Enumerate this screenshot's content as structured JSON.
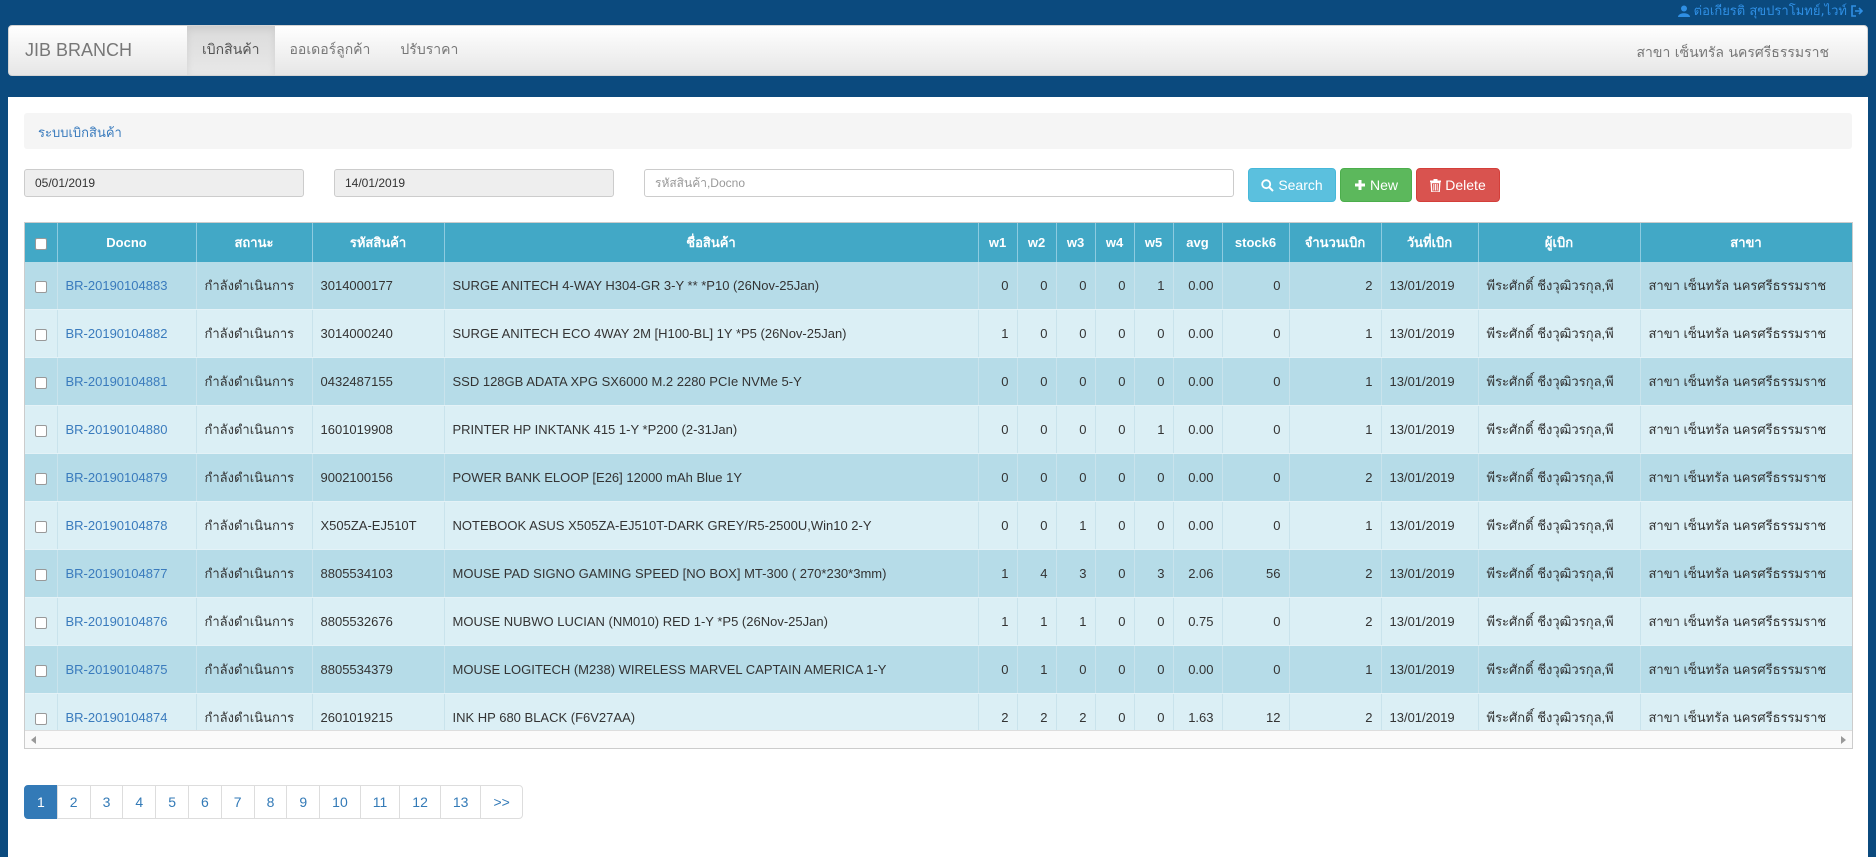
{
  "topbar": {
    "user_name": "ต่อเกียรติ สุขปราโมทย์,ไวท์"
  },
  "navbar": {
    "brand": "JIB BRANCH",
    "items": [
      {
        "label": "เบิกสินค้า",
        "active": true
      },
      {
        "label": "ออเดอร์ลูกค้า",
        "active": false
      },
      {
        "label": "ปรับราคา",
        "active": false
      }
    ],
    "branch": "สาขา เซ็นทรัล นครศรีธรรมราช"
  },
  "panel": {
    "title": "ระบบเบิกสินค้า"
  },
  "filters": {
    "date_from": "05/01/2019",
    "date_to": "14/01/2019",
    "search_placeholder": "รหัสสินค้า,Docno",
    "search_label": "Search",
    "new_label": "New",
    "delete_label": "Delete"
  },
  "table": {
    "columns": [
      "Docno",
      "สถานะ",
      "รหัสสินค้า",
      "ชื่อสินค้า",
      "w1",
      "w2",
      "w3",
      "w4",
      "w5",
      "avg",
      "stock6",
      "จำนวนเบิก",
      "วันที่เบิก",
      "ผู้เบิก",
      "สาขา"
    ],
    "rows": [
      {
        "docno": "BR-20190104883",
        "status": "กำลังดำเนินการ",
        "code": "3014000177",
        "name": "SURGE ANITECH 4-WAY H304-GR 3-Y ** *P10 (26Nov-25Jan)",
        "w1": "0",
        "w2": "0",
        "w3": "0",
        "w4": "0",
        "w5": "1",
        "avg": "0.00",
        "stock6": "0",
        "qty": "2",
        "date": "13/01/2019",
        "requester": "พีระศักดิ์ ชีงวุฒิวรกุล,พี",
        "branch": "สาขา เซ็นทรัล นครศรีธรรมราช"
      },
      {
        "docno": "BR-20190104882",
        "status": "กำลังดำเนินการ",
        "code": "3014000240",
        "name": "SURGE ANITECH ECO 4WAY 2M [H100-BL] 1Y *P5 (26Nov-25Jan)",
        "w1": "1",
        "w2": "0",
        "w3": "0",
        "w4": "0",
        "w5": "0",
        "avg": "0.00",
        "stock6": "0",
        "qty": "1",
        "date": "13/01/2019",
        "requester": "พีระศักดิ์ ชีงวุฒิวรกุล,พี",
        "branch": "สาขา เซ็นทรัล นครศรีธรรมราช"
      },
      {
        "docno": "BR-20190104881",
        "status": "กำลังดำเนินการ",
        "code": "0432487155",
        "name": "SSD 128GB ADATA XPG SX6000 M.2 2280 PCIe NVMe 5-Y",
        "w1": "0",
        "w2": "0",
        "w3": "0",
        "w4": "0",
        "w5": "0",
        "avg": "0.00",
        "stock6": "0",
        "qty": "1",
        "date": "13/01/2019",
        "requester": "พีระศักดิ์ ชีงวุฒิวรกุล,พี",
        "branch": "สาขา เซ็นทรัล นครศรีธรรมราช"
      },
      {
        "docno": "BR-20190104880",
        "status": "กำลังดำเนินการ",
        "code": "1601019908",
        "name": "PRINTER HP INKTANK 415 1-Y *P200 (2-31Jan)",
        "w1": "0",
        "w2": "0",
        "w3": "0",
        "w4": "0",
        "w5": "1",
        "avg": "0.00",
        "stock6": "0",
        "qty": "1",
        "date": "13/01/2019",
        "requester": "พีระศักดิ์ ชีงวุฒิวรกุล,พี",
        "branch": "สาขา เซ็นทรัล นครศรีธรรมราช"
      },
      {
        "docno": "BR-20190104879",
        "status": "กำลังดำเนินการ",
        "code": "9002100156",
        "name": "POWER BANK ELOOP [E26] 12000 mAh Blue 1Y",
        "w1": "0",
        "w2": "0",
        "w3": "0",
        "w4": "0",
        "w5": "0",
        "avg": "0.00",
        "stock6": "0",
        "qty": "2",
        "date": "13/01/2019",
        "requester": "พีระศักดิ์ ชีงวุฒิวรกุล,พี",
        "branch": "สาขา เซ็นทรัล นครศรีธรรมราช"
      },
      {
        "docno": "BR-20190104878",
        "status": "กำลังดำเนินการ",
        "code": "X505ZA-EJ510T",
        "name": "NOTEBOOK ASUS X505ZA-EJ510T-DARK GREY/R5-2500U,Win10 2-Y",
        "w1": "0",
        "w2": "0",
        "w3": "1",
        "w4": "0",
        "w5": "0",
        "avg": "0.00",
        "stock6": "0",
        "qty": "1",
        "date": "13/01/2019",
        "requester": "พีระศักดิ์ ชีงวุฒิวรกุล,พี",
        "branch": "สาขา เซ็นทรัล นครศรีธรรมราช"
      },
      {
        "docno": "BR-20190104877",
        "status": "กำลังดำเนินการ",
        "code": "8805534103",
        "name": "MOUSE PAD SIGNO GAMING SPEED [NO BOX] MT-300 ( 270*230*3mm)",
        "w1": "1",
        "w2": "4",
        "w3": "3",
        "w4": "0",
        "w5": "3",
        "avg": "2.06",
        "stock6": "56",
        "qty": "2",
        "date": "13/01/2019",
        "requester": "พีระศักดิ์ ชีงวุฒิวรกุล,พี",
        "branch": "สาขา เซ็นทรัล นครศรีธรรมราช"
      },
      {
        "docno": "BR-20190104876",
        "status": "กำลังดำเนินการ",
        "code": "8805532676",
        "name": "MOUSE NUBWO LUCIAN (NM010) RED 1-Y *P5 (26Nov-25Jan)",
        "w1": "1",
        "w2": "1",
        "w3": "1",
        "w4": "0",
        "w5": "0",
        "avg": "0.75",
        "stock6": "0",
        "qty": "2",
        "date": "13/01/2019",
        "requester": "พีระศักดิ์ ชีงวุฒิวรกุล,พี",
        "branch": "สาขา เซ็นทรัล นครศรีธรรมราช"
      },
      {
        "docno": "BR-20190104875",
        "status": "กำลังดำเนินการ",
        "code": "8805534379",
        "name": "MOUSE LOGITECH (M238) WIRELESS MARVEL CAPTAIN AMERICA 1-Y",
        "w1": "0",
        "w2": "1",
        "w3": "0",
        "w4": "0",
        "w5": "0",
        "avg": "0.00",
        "stock6": "0",
        "qty": "1",
        "date": "13/01/2019",
        "requester": "พีระศักดิ์ ชีงวุฒิวรกุล,พี",
        "branch": "สาขา เซ็นทรัล นครศรีธรรมราช"
      },
      {
        "docno": "BR-20190104874",
        "status": "กำลังดำเนินการ",
        "code": "2601019215",
        "name": "INK HP 680 BLACK (F6V27AA)",
        "w1": "2",
        "w2": "2",
        "w3": "2",
        "w4": "0",
        "w5": "0",
        "avg": "1.63",
        "stock6": "12",
        "qty": "2",
        "date": "13/01/2019",
        "requester": "พีระศักดิ์ ชีงวุฒิวรกุล,พี",
        "branch": "สาขา เซ็นทรัล นครศรีธรรมราช"
      }
    ]
  },
  "pagination": {
    "pages": [
      "1",
      "2",
      "3",
      "4",
      "5",
      "6",
      "7",
      "8",
      "9",
      "10",
      "11",
      "12",
      "13"
    ],
    "current": "1",
    "next_label": ">>"
  },
  "colors": {
    "background": "#0b4a7e",
    "table_header": "#42a8c6",
    "row_odd": "#b6dce8",
    "row_even": "#dbeff5",
    "link": "#3a7bbd",
    "search_button": "#5bc0de",
    "new_button": "#5cb85c",
    "delete_button": "#d9534f"
  },
  "icons": {
    "user": "user-icon",
    "logout": "sign-out-icon",
    "search": "search-icon",
    "new": "plus-icon",
    "delete": "trash-icon"
  }
}
